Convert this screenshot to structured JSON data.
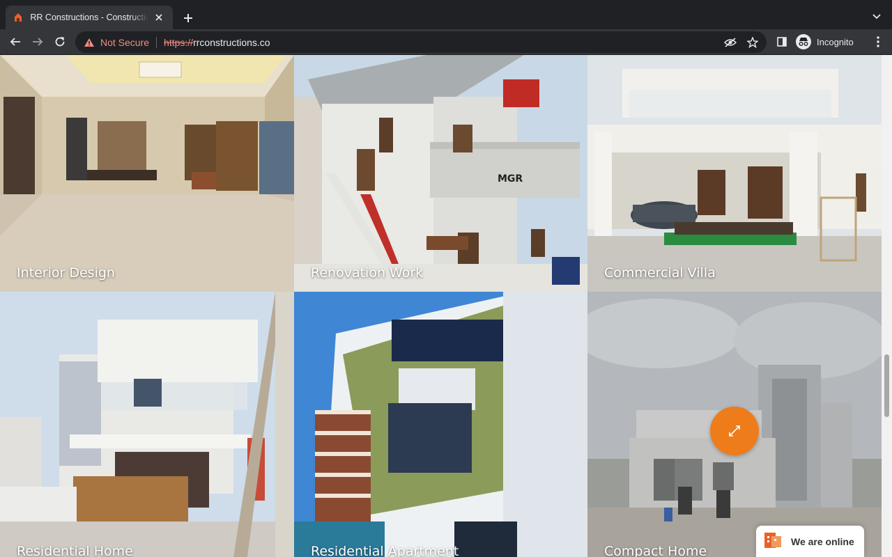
{
  "browser": {
    "tab_title": "RR Constructions - Construction Company",
    "omnibox": {
      "security_label": "Not Secure",
      "url_scheme": "https://",
      "url_host": "rrconstructions.co"
    },
    "profile_label": "Incognito"
  },
  "gallery": {
    "tiles": [
      {
        "caption": "Interior Design"
      },
      {
        "caption": "Renovation Work"
      },
      {
        "caption": "Commercial Villa"
      },
      {
        "caption": "Residential Home"
      },
      {
        "caption": "Residential Apartment"
      },
      {
        "caption": "Compact Home"
      }
    ]
  },
  "sign_text": "MGR",
  "chat_widget": {
    "label": "We are online"
  },
  "colors": {
    "accent": "#ee7c1b",
    "warning": "#f28b82"
  }
}
